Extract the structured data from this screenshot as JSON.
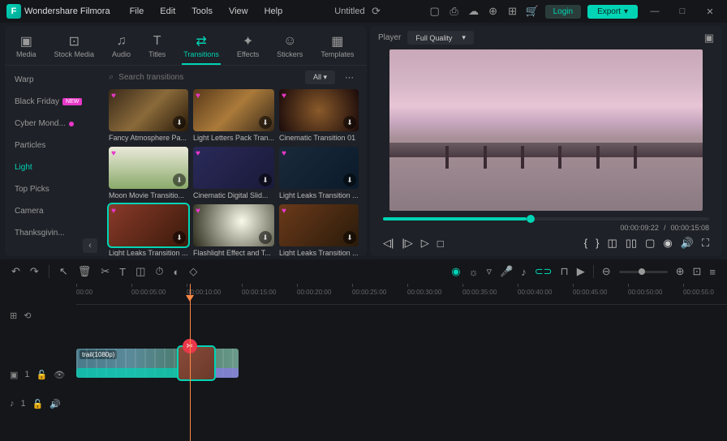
{
  "app": {
    "name": "Wondershare Filmora",
    "doc": "Untitled"
  },
  "menu": [
    "File",
    "Edit",
    "Tools",
    "View",
    "Help"
  ],
  "titlebar": {
    "login": "Login",
    "export": "Export"
  },
  "tabs": [
    {
      "icon": "▣",
      "label": "Media"
    },
    {
      "icon": "⊡",
      "label": "Stock Media"
    },
    {
      "icon": "♫",
      "label": "Audio"
    },
    {
      "icon": "T",
      "label": "Titles"
    },
    {
      "icon": "⇄",
      "label": "Transitions"
    },
    {
      "icon": "✦",
      "label": "Effects"
    },
    {
      "icon": "☺",
      "label": "Stickers"
    },
    {
      "icon": "▦",
      "label": "Templates"
    }
  ],
  "sidebar": [
    {
      "label": "Warp"
    },
    {
      "label": "Black Friday",
      "badge": "NEW"
    },
    {
      "label": "Cyber Mond...",
      "dot": true
    },
    {
      "label": "Particles"
    },
    {
      "label": "Light",
      "active": true
    },
    {
      "label": "Top Picks"
    },
    {
      "label": "Camera"
    },
    {
      "label": "Thanksgivin..."
    }
  ],
  "search": {
    "placeholder": "Search transitions",
    "filter": "All"
  },
  "cards": [
    {
      "label": "Fancy Atmosphere Pa...",
      "bg": "linear-gradient(135deg,#3a2a1a,#8a6a3a,#2a1a0a)"
    },
    {
      "label": "Light Letters Pack Tran...",
      "bg": "linear-gradient(135deg,#5a3a1a,#aa7a3a,#3a2a1a)"
    },
    {
      "label": "Cinematic Transition 01",
      "bg": "radial-gradient(circle,#8a5a2a,#1a0a0a)"
    },
    {
      "label": "Moon Movie Transitio...",
      "bg": "linear-gradient(180deg,#eaeada,#8aaa6a)"
    },
    {
      "label": "Cinematic Digital Slid...",
      "bg": "linear-gradient(135deg,#2a2a5a,#1a1a3a)"
    },
    {
      "label": "Light Leaks Transition ...",
      "bg": "linear-gradient(135deg,#1a2a3a,#0a1a2a)"
    },
    {
      "label": "Light Leaks Transition ...",
      "bg": "linear-gradient(135deg,#8a3a2a,#3a1a0a)",
      "selected": true
    },
    {
      "label": "Flashlight Effect and T...",
      "bg": "radial-gradient(circle at 60% 40%,#fafaea,#2a2a1a)"
    },
    {
      "label": "Light Leaks Transition ...",
      "bg": "linear-gradient(135deg,#6a3a1a,#2a1a0a)"
    }
  ],
  "player": {
    "label": "Player",
    "quality": "Full Quality",
    "current": "00:00:09:22",
    "sep": "/",
    "total": "00:00:15:08"
  },
  "ruler": [
    "00:00",
    "00:00:05:00",
    "00:00:10:00",
    "00:00:15:00",
    "00:00:20:00",
    "00:00:25:00",
    "00:00:30:00",
    "00:00:35:00",
    "00:00:40:00",
    "00:00:45:00",
    "00:00:50:00",
    "00:00:55:0"
  ],
  "clip": {
    "label": "trail(1080p)"
  },
  "tracks": {
    "video": "1",
    "audio": "1"
  }
}
